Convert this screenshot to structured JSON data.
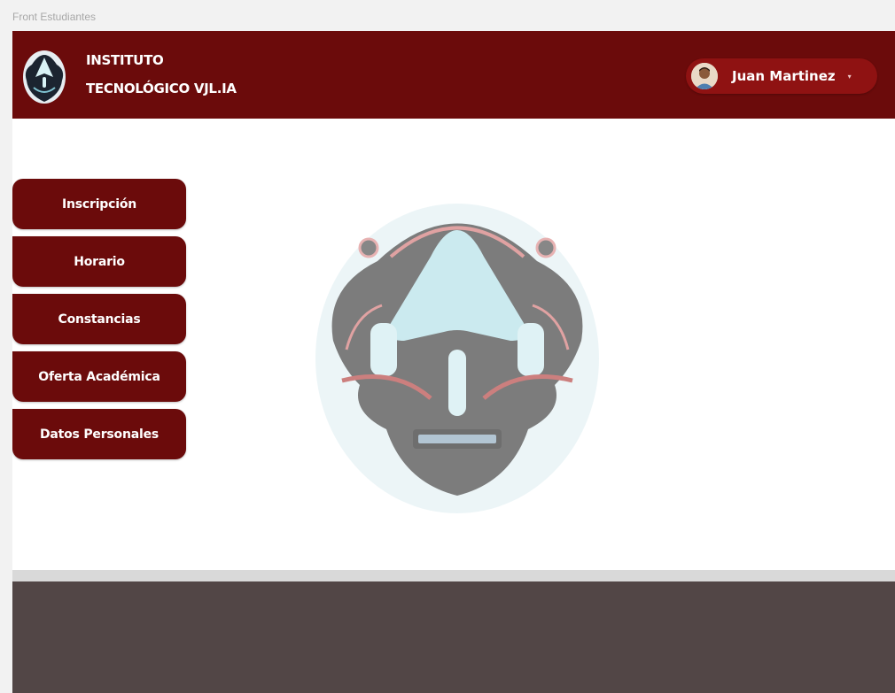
{
  "frame": {
    "label": "Front Estudiantes"
  },
  "header": {
    "institution_line1": "INSTITUTO",
    "institution_line2": "TECNOLÓGICO VJL.IA",
    "logo_icon": "institute-logo-icon",
    "user": {
      "name": "Juan Martinez",
      "caret": "▾",
      "avatar_icon": "user-avatar-icon"
    }
  },
  "nav": {
    "items": [
      {
        "label": "Inscripción"
      },
      {
        "label": "Horario"
      },
      {
        "label": "Constancias"
      },
      {
        "label": "Oferta Académica"
      },
      {
        "label": "Datos Personales"
      }
    ]
  },
  "watermark": {
    "icon": "institute-emblem-watermark"
  },
  "colors": {
    "primary": "#6b0b0b",
    "user_pill": "#8f1212",
    "footer": "#524646",
    "divider": "#d9d9d9"
  }
}
